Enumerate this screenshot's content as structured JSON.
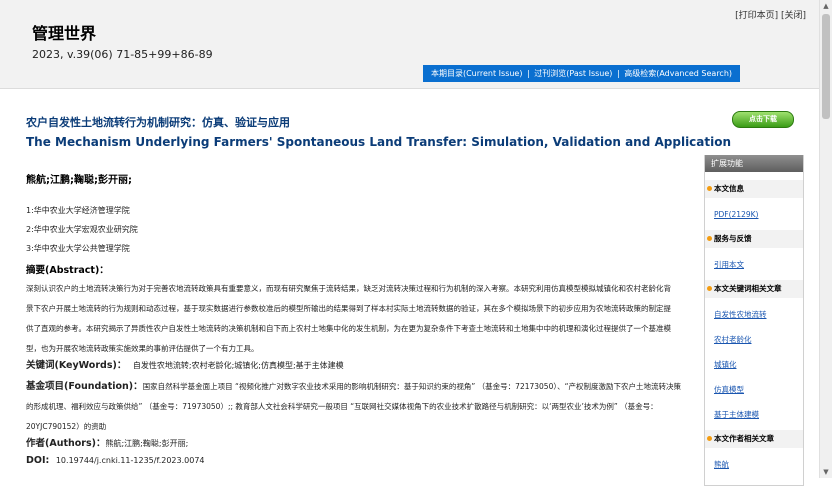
{
  "header": {
    "journal_title": "管理世界",
    "issue_info": "2023, v.39(06) 71-85+99+86-89",
    "print_link": "[打印本页]",
    "close_link": "[关闭]",
    "nav": {
      "current_issue": "本期目录(Current Issue)",
      "past_issue": "过刊浏览(Past Issue)",
      "advanced_search": "高级检索(Advanced Search)",
      "separator": "|"
    }
  },
  "article": {
    "title_cn": "农户自发性土地流转行为机制研究：仿真、验证与应用",
    "title_en": "The Mechanism Underlying Farmers' Spontaneous Land Transfer: Simulation, Validation and Application",
    "download_label": "点击下载",
    "authors": "熊航;江鹏;鞠聪;彭开丽;",
    "affiliations": [
      "1:华中农业大学经济管理学院",
      "2:华中农业大学宏观农业研究院",
      "3:华中农业大学公共管理学院"
    ],
    "abstract_label": "摘要(Abstract)：",
    "abstract_text": "深刻认识农户的土地流转决策行为对于完善农地流转政策具有重要意义，而现有研究聚焦于流转结果，缺乏对流转决策过程和行为机制的深入考察。本研究利用仿真模型模拟城镇化和农村老龄化背景下农户开展土地流转的行为规则和动态过程，基于现实数据进行参数校准后的模型所输出的结果得到了样本村实际土地流转数据的验证，其在多个模拟场景下的初步应用为农地流转政策的制定提供了直观的参考。本研究揭示了异质性农户自发性土地流转的决策机制和自下而上农村土地集中化的发生机制，为在更为复杂条件下考查土地流转和土地集中中的机理和演化过程提供了一个基准模型，也为开展农地流转政策实施效果的事前评估提供了一个有力工具。",
    "keywords_label": "关键词(KeyWords)：",
    "keywords_text": "自发性农地流转;农村老龄化;城镇化;仿真模型;基于主体建模",
    "funding_label": "基金项目(Foundation)：",
    "funding_text": "国家自然科学基金面上项目 “视频化推广对数字农业技术采用的影响机制研究：基于知识约束的视角” （基金号：72173050）、“产权制度激励下农户土地流转决策的形成机理、福利效应与政策供给” （基金号：71973050）;; 教育部人文社会科学研究一般项目 “互联网社交媒体视角下的农业技术扩散路径与机制研究：以‘两型农业’技术为例” （基金号：20YJC790152）的资助",
    "authors_label": "作者(Authors)：",
    "authors_text": "熊航;江鹏;鞠聪;彭开丽;",
    "doi_label": "DOI:",
    "doi_text": "10.19744/j.cnki.11-1235/f.2023.0074"
  },
  "sidebar": {
    "header": "扩展功能",
    "sections": {
      "info": "本文信息",
      "service": "服务与反馈",
      "keywords": "本文关键词相关文章",
      "authors": "本文作者相关文章"
    },
    "links": {
      "pdf": "PDF(2129K)",
      "cite": "引用本文",
      "kw1": "自发性农地流转",
      "kw2": "农村老龄化",
      "kw3": "城镇化",
      "kw4": "仿真模型",
      "kw5": "基于主体建模",
      "author1": "熊航"
    }
  }
}
